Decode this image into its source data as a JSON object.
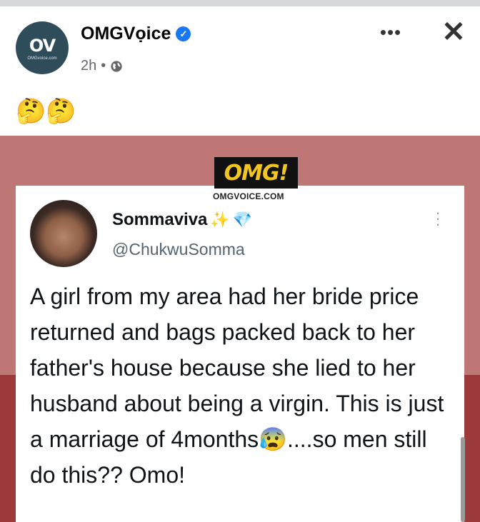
{
  "post": {
    "page_name": "OMGVọice",
    "time": "2h",
    "separator": "•",
    "text": "🤔🤔",
    "avatar_logo": "OV",
    "avatar_sub": "OMGvoice.com"
  },
  "actions": {
    "more": "•••",
    "close": "✕"
  },
  "media": {
    "brand_logo": "OMG!",
    "brand_url": "OMGVOICE.COM",
    "tweet": {
      "name": "Sommaviva",
      "name_emoji_1": "✨",
      "name_emoji_2": "💎",
      "handle": "@ChukwuSomma",
      "menu": "⋮",
      "body": "A girl from my area had her bride price returned and bags packed back to her father's house because she lied to her husband about being a virgin. This is just a marriage of 4months😰....so men still do this?? Omo!"
    }
  },
  "colors": {
    "verified": "#1877f2",
    "media_bg_top": "#be7774",
    "media_bg_bottom": "#9c3a39",
    "brand_yellow": "#f3c520"
  },
  "icons": [
    "verified-badge-icon",
    "globe-icon",
    "more-options-icon",
    "close-icon",
    "tweet-menu-icon"
  ]
}
